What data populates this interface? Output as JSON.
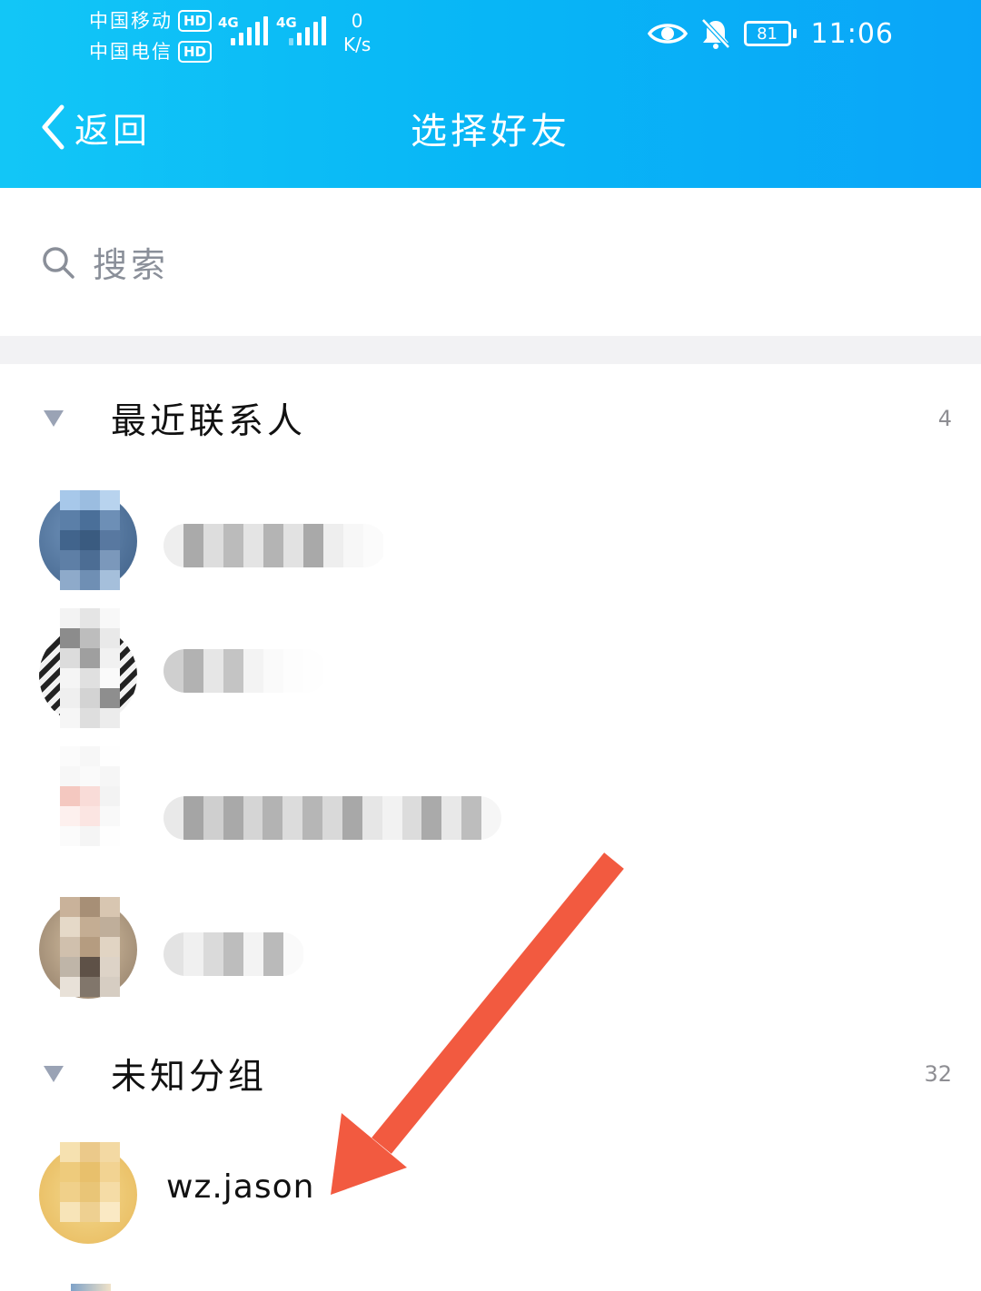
{
  "status_bar": {
    "carrier_1": "中国移动",
    "carrier_2": "中国电信",
    "hd_badge": "HD",
    "network_type_1": "4G",
    "network_type_2": "4G",
    "net_speed_value": "0",
    "net_speed_unit": "K/s",
    "battery": "81",
    "time": "11:06",
    "icons": [
      "eye-icon",
      "bell-muted-icon",
      "battery-icon"
    ]
  },
  "nav": {
    "back_label": "返回",
    "title": "选择好友"
  },
  "search": {
    "placeholder": "搜索"
  },
  "groups": [
    {
      "title": "最近联系人",
      "count": "4"
    },
    {
      "title": "未知分组",
      "count": "32"
    }
  ],
  "contacts": {
    "visible_name": "wz.jason"
  },
  "colors": {
    "header_gradient_start": "#12c6f7",
    "header_gradient_end": "#0aa5f8",
    "arrow_annotation": "#f25a40",
    "group_arrow": "#9aa3b5"
  }
}
